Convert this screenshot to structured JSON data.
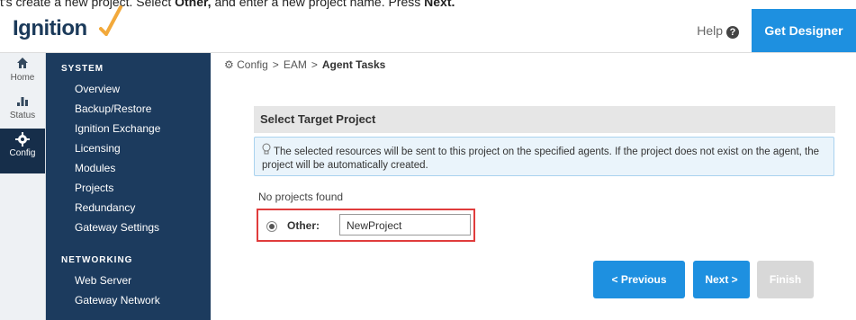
{
  "caption": {
    "prefix": "t's create a new project. Select ",
    "bold1": "Other,",
    "middle": " and enter a new project name. Press ",
    "bold2": "Next."
  },
  "header": {
    "logo_text": "Ignition",
    "help_label": "Help",
    "help_icon": "?",
    "get_designer_label": "Get Designer"
  },
  "rail": {
    "home": {
      "label": "Home",
      "icon": "home-icon"
    },
    "status": {
      "label": "Status",
      "icon": "bar-chart-icon"
    },
    "config": {
      "label": "Config",
      "icon": "gear-icon"
    }
  },
  "sidebar": {
    "system_title": "SYSTEM",
    "system_items": [
      "Overview",
      "Backup/Restore",
      "Ignition Exchange",
      "Licensing",
      "Modules",
      "Projects",
      "Redundancy",
      "Gateway Settings"
    ],
    "networking_title": "NETWORKING",
    "networking_items": [
      "Web Server",
      "Gateway Network"
    ]
  },
  "breadcrumb": {
    "root": "Config",
    "middle": "EAM",
    "current": "Agent Tasks"
  },
  "panel": {
    "title": "Select Target Project",
    "info_text": "The selected resources will be sent to this project on the specified agents. If the project does not exist on the agent, the project will be automatically created.",
    "no_projects": "No projects found",
    "other_label": "Other:",
    "project_name_value": "NewProject"
  },
  "buttons": {
    "previous": "< Previous",
    "next": "Next >",
    "finish": "Finish"
  },
  "colors": {
    "accent": "#1e90e0",
    "sidebar_bg": "#1c3b5e",
    "highlight_border": "#e03c3c"
  }
}
